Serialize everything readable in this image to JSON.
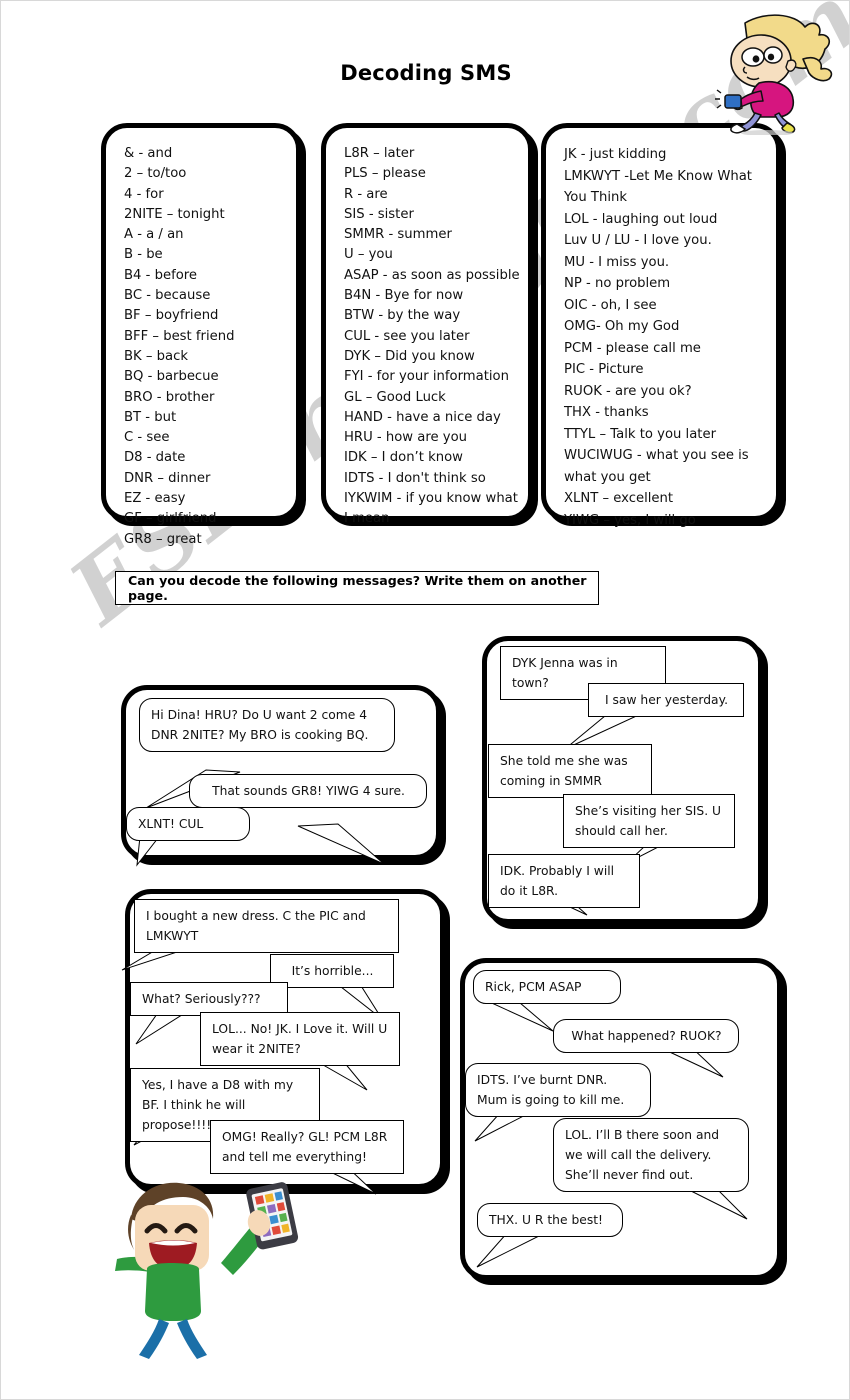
{
  "page": {
    "title": "Decoding SMS",
    "watermark": "ESLprintables.com"
  },
  "instruction": {
    "text": "Can you decode the following messages? Write them on another page."
  },
  "glossary": {
    "columns": [
      {
        "id": "column-1",
        "entries": [
          "& - and",
          "2 – to/too",
          "4 - for",
          "2NITE – tonight",
          "A - a / an",
          "B - be",
          "B4 - before",
          "BC - because",
          "BF – boyfriend",
          "BFF – best friend",
          "BK – back",
          "BQ - barbecue",
          "BRO - brother",
          "BT - but",
          "C - see",
          "D8 - date",
          "DNR – dinner",
          "EZ - easy",
          "GF – girlfriend",
          "GR8 – great"
        ]
      },
      {
        "id": "column-2",
        "entries": [
          "L8R – later",
          "PLS – please",
          "R - are",
          "SIS - sister",
          "SMMR - summer",
          "U – you",
          "ASAP - as soon as possible",
          "B4N - Bye for now",
          "BTW - by the way",
          "CUL - see you later",
          "DYK – Did you know",
          "FYI - for your information",
          "GL – Good Luck",
          "HAND - have a nice day",
          "HRU - how are you",
          "IDK – I don’t know",
          "IDTS - I don't think so",
          "IYKWIM - if you know what I mean"
        ]
      },
      {
        "id": "column-3",
        "entries": [
          "JK - just kidding",
          "LMKWYT -Let Me Know What You Think",
          "LOL - laughing out loud",
          "Luv U / LU - I love you.",
          "MU - I miss you.",
          "NP - no problem",
          "OIC - oh, I see",
          "OMG- Oh my God",
          "PCM - please call me",
          "PIC - Picture",
          "RUOK - are you ok?",
          "THX - thanks",
          "TTYL – Talk to you later",
          "WUCIWUG - what you see is what you get",
          "XLNT – excellent",
          "YIWG – yes, I will go"
        ]
      }
    ]
  },
  "conversations": [
    {
      "id": "conversation-1",
      "messages": [
        "Hi Dina! HRU? Do U want 2 come 4 DNR 2NITE? My BRO is cooking BQ.",
        "That sounds GR8! YIWG 4 sure.",
        "XLNT! CUL"
      ]
    },
    {
      "id": "conversation-2",
      "messages": [
        "DYK Jenna was in town?",
        "I saw her yesterday.",
        "She told me she was coming in SMMR",
        "She’s visiting her SIS. U should call her.",
        "IDK. Probably I will do it L8R."
      ]
    },
    {
      "id": "conversation-3",
      "messages": [
        "I bought a new dress. C the PIC and LMKWYT",
        "It’s horrible...",
        "What? Seriously???",
        "LOL... No! JK. I Love it. Will U wear it 2NITE?",
        "Yes, I have a D8 with my BF. I think he will propose!!!!",
        "OMG! Really? GL! PCM L8R and tell me everything!"
      ]
    },
    {
      "id": "conversation-4",
      "messages": [
        "Rick, PCM ASAP",
        "What happened? RUOK?",
        "IDTS. I’ve burnt DNR. Mum is going to kill me.",
        "LOL. I’ll B there soon and we will call the delivery. She’ll never find out.",
        "THX. U R the best!"
      ]
    }
  ],
  "clipart": {
    "girl": {
      "name": "girl-texting-clipart",
      "hair": "#f2da8a",
      "shirt": "#d6157f",
      "pants": "#8f93d6",
      "skin": "#f6dfc0",
      "phone": "#2f6fc4",
      "shoe": "#e8e14a"
    },
    "boy": {
      "name": "boy-with-smartphone-clipart",
      "hair": "#5e4228",
      "shirt": "#2e9b3f",
      "pants": "#1b6fa8",
      "skin": "#f6d9b8",
      "phone": "#3c3c44",
      "mouth": "#9e1b22"
    }
  }
}
